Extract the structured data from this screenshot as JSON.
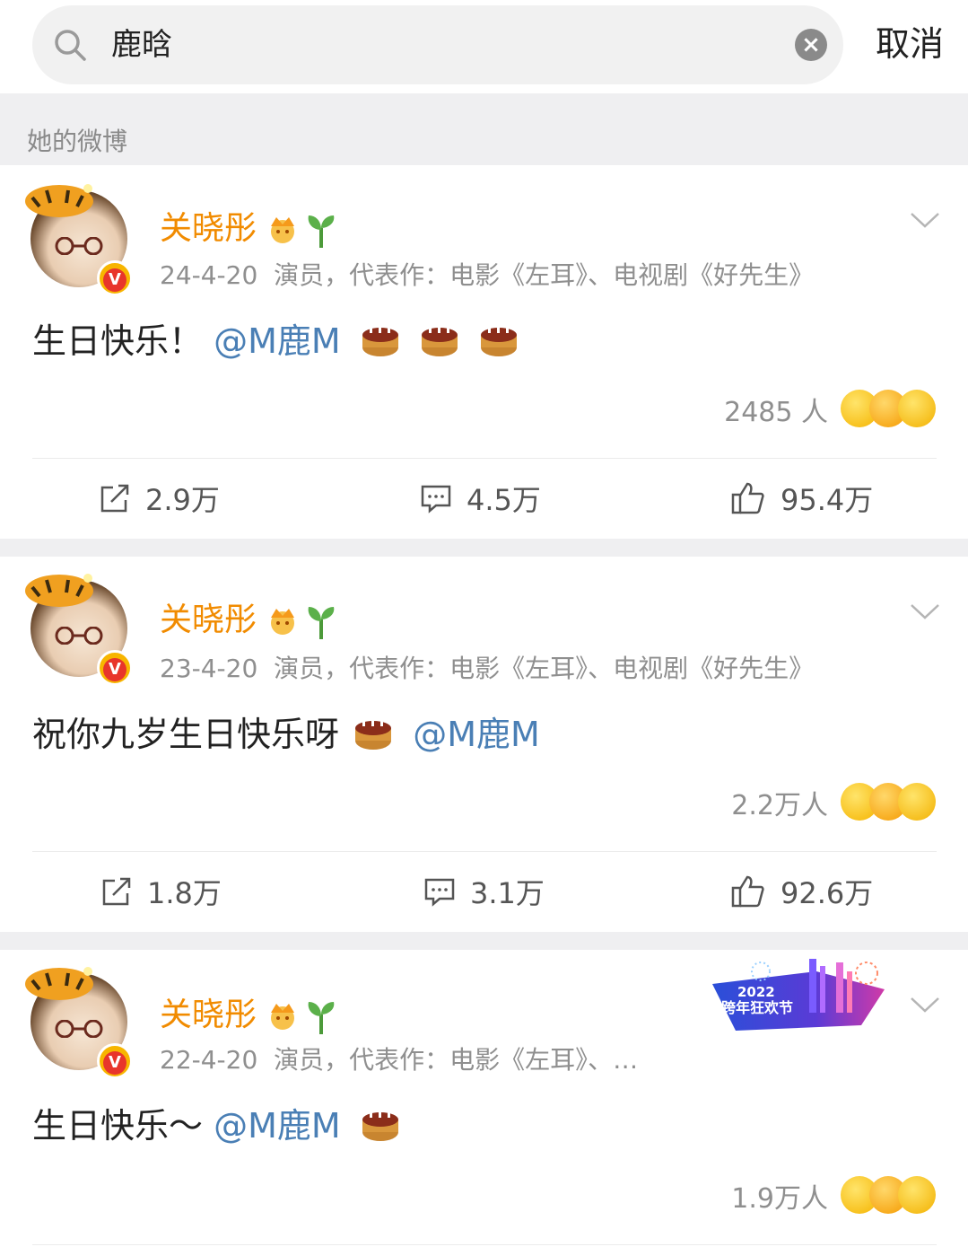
{
  "search": {
    "query": "鹿晗",
    "cancel_label": "取消"
  },
  "section": {
    "title": "她的微博"
  },
  "posts": [
    {
      "username": "关晓彤",
      "date": "24-4-20",
      "bio": "演员，代表作：电影《左耳》、电视剧《好先生》",
      "text_prefix": "生日快乐！",
      "mention": "@M鹿M",
      "reaction_count": "2485 人",
      "repost_count": "2.9万",
      "comment_count": "4.5万",
      "like_count": "95.4万"
    },
    {
      "username": "关晓彤",
      "date": "23-4-20",
      "bio": "演员，代表作：电影《左耳》、电视剧《好先生》",
      "text_prefix": "祝你九岁生日快乐呀",
      "mention": "@M鹿M",
      "reaction_count": "2.2万人",
      "repost_count": "1.8万",
      "comment_count": "3.1万",
      "like_count": "92.6万"
    },
    {
      "username": "关晓彤",
      "date": "22-4-20",
      "bio": "演员，代表作：电影《左耳》、…",
      "text_prefix": "生日快乐～",
      "mention": "@M鹿M",
      "reaction_count": "1.9万人",
      "banner_year": "2022",
      "banner_text": "跨年狂欢节"
    }
  ],
  "colors": {
    "username": "#f18b00",
    "mention": "#4a7fb5",
    "meta": "#8f8f8f",
    "section_bg": "#efeff1"
  },
  "icons": [
    "search-icon",
    "clear-icon",
    "crown-icon",
    "sprout-icon",
    "chevron-down-icon",
    "cake-icon",
    "repost-icon",
    "comment-icon",
    "like-icon",
    "verified-icon"
  ]
}
